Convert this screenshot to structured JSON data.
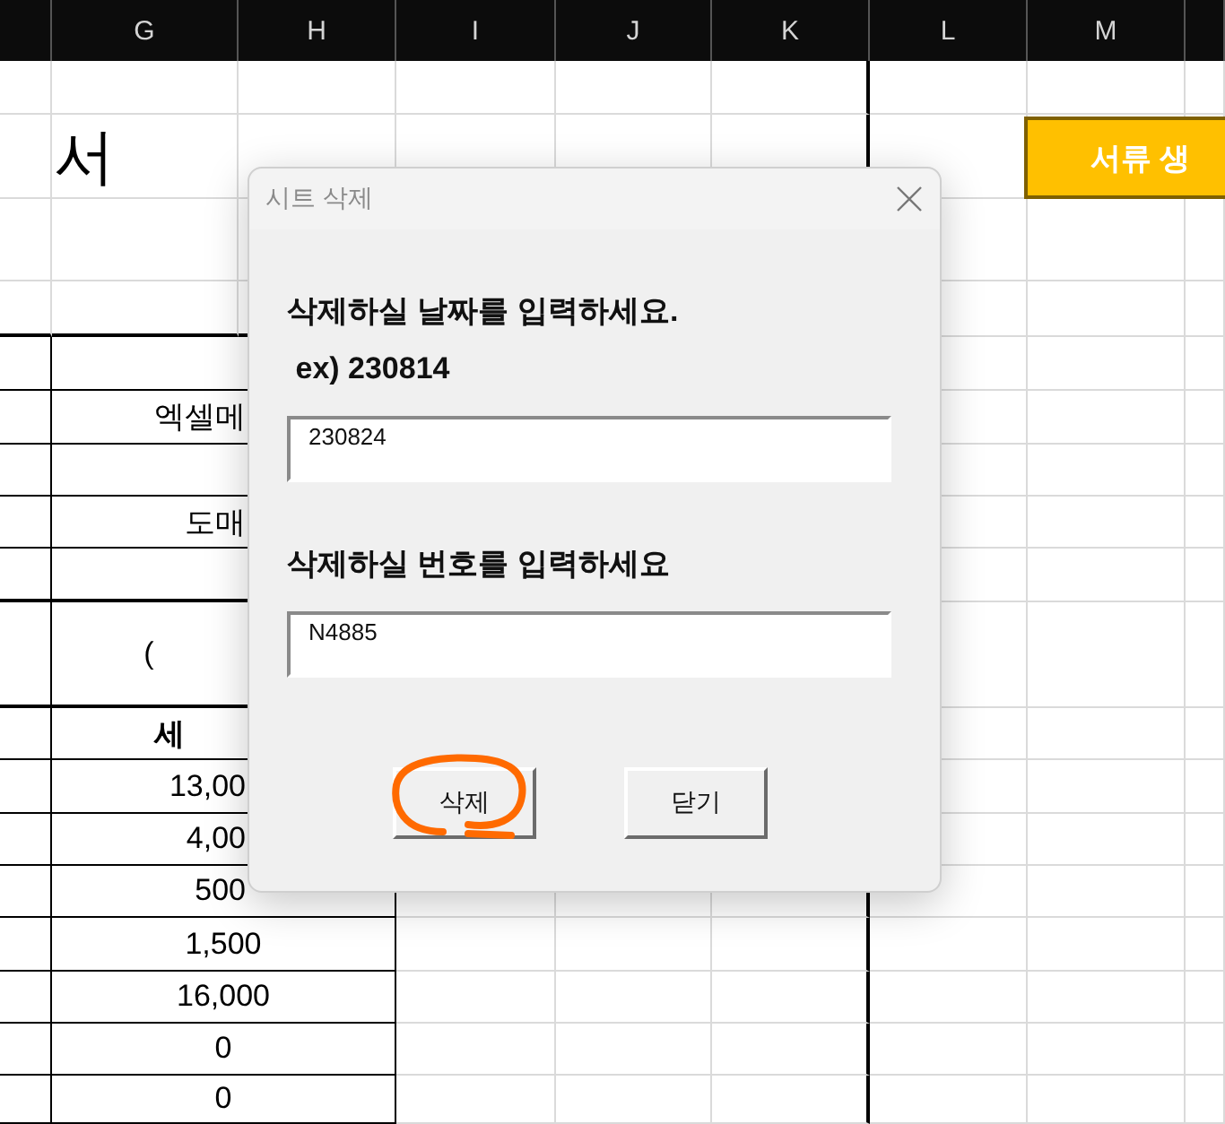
{
  "sheet": {
    "column_headers": [
      "G",
      "H",
      "I",
      "J",
      "K",
      "L",
      "M"
    ],
    "title": "서",
    "action_button": "서류 생",
    "rows": [
      {},
      {
        "value": "엑셀메"
      },
      {},
      {
        "value": "도매"
      },
      {},
      {
        "value": "("
      },
      {
        "value": "세",
        "header": true
      },
      {
        "value": "13,00"
      },
      {
        "value": "4,00"
      },
      {
        "value": "500"
      },
      {
        "value": "1,500"
      },
      {
        "value": "16,000"
      },
      {
        "value": "0"
      },
      {
        "value": "0"
      }
    ]
  },
  "dialog": {
    "title": "시트 삭제",
    "fields": [
      {
        "label": "삭제하실 날짜를 입력하세요.\n ex) 230814",
        "value": "230824"
      },
      {
        "label": "삭제하실 번호를 입력하세요",
        "value": "N4885"
      }
    ],
    "buttons": [
      {
        "label": "삭제",
        "circled": true
      },
      {
        "label": "닫기",
        "circled": false
      }
    ]
  }
}
